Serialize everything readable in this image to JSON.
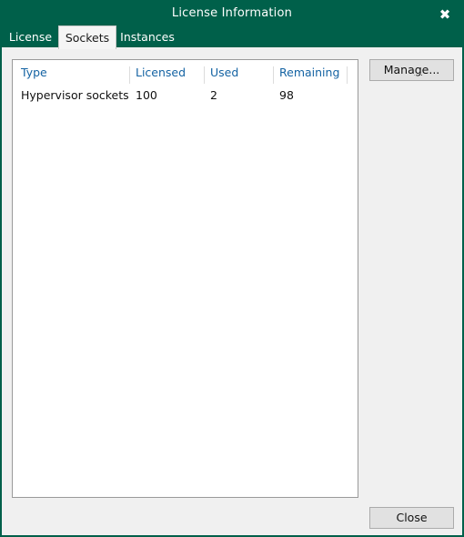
{
  "window": {
    "title": "License Information",
    "close_icon": "close-icon",
    "accent_green": "#00604A",
    "body_background": "#F0F0F0",
    "header_text_color": "#1463A3"
  },
  "tabs": [
    {
      "label": "License",
      "active": false
    },
    {
      "label": "Sockets",
      "active": true
    },
    {
      "label": "Instances",
      "active": false
    }
  ],
  "table": {
    "columns": [
      "Type",
      "Licensed",
      "Used",
      "Remaining"
    ],
    "rows": [
      {
        "type": "Hypervisor sockets",
        "licensed": "100",
        "used": "2",
        "remaining": "98"
      }
    ]
  },
  "buttons": {
    "manage": {
      "label_before": "Mana",
      "accesskey": "g",
      "label_after": "e..."
    },
    "close": {
      "label": "Close"
    }
  }
}
